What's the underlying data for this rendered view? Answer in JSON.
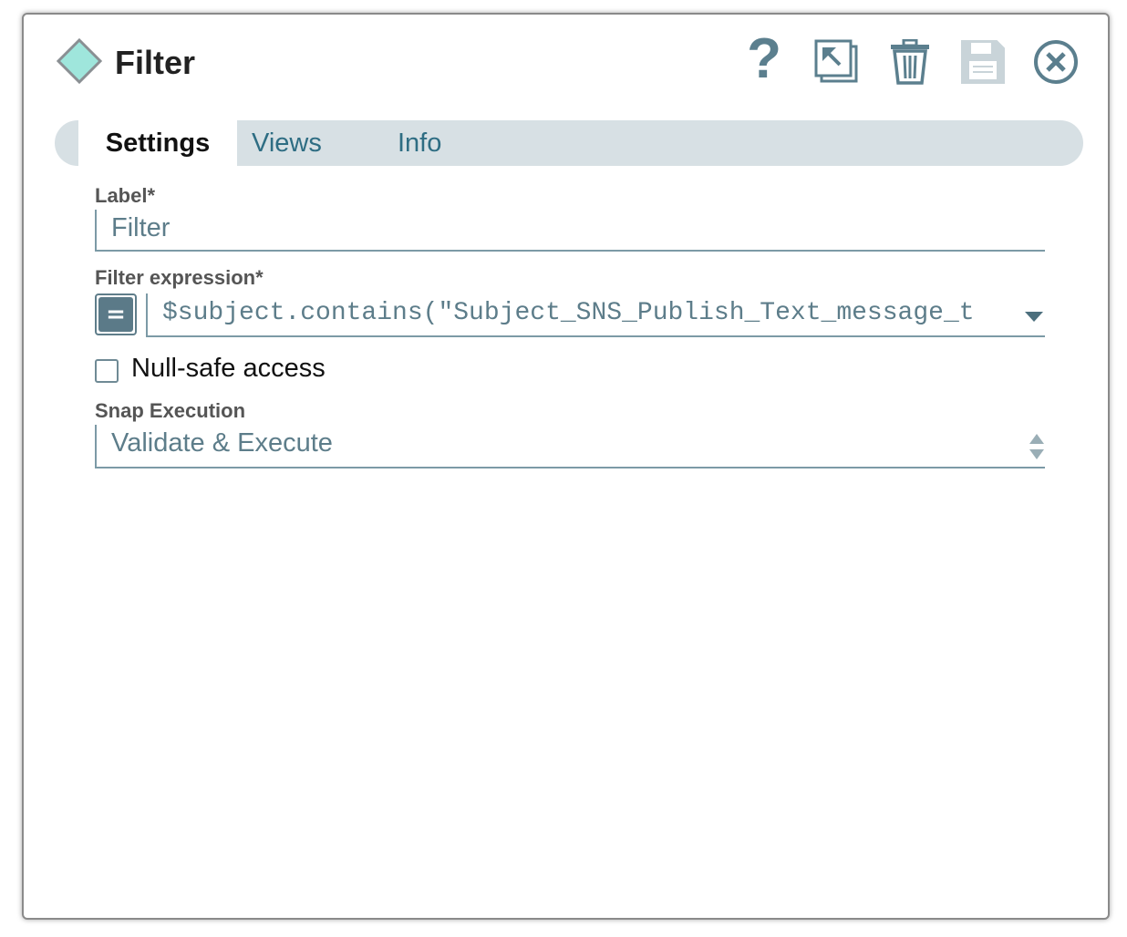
{
  "dialog": {
    "title": "Filter",
    "icon": "diamond-icon"
  },
  "toolbar": {
    "help_glyph": "?",
    "icons": [
      "help-icon",
      "export-icon",
      "trash-icon",
      "save-icon",
      "close-icon"
    ]
  },
  "tabs": [
    {
      "label": "Settings",
      "active": true
    },
    {
      "label": "Views",
      "active": false
    },
    {
      "label": "Info",
      "active": false
    }
  ],
  "settings": {
    "label_field": {
      "label": "Label*",
      "value": "Filter"
    },
    "filter_expression": {
      "label": "Filter expression*",
      "expression_toggle": "=",
      "value": "$subject.contains(\"Subject_SNS_Publish_Text_message_t"
    },
    "null_safe": {
      "label": "Null-safe access",
      "checked": false
    },
    "snap_execution": {
      "label": "Snap Execution",
      "value": "Validate & Execute"
    }
  },
  "colors": {
    "accent": "#5b7f8e",
    "tab_bar": "#d7e0e4",
    "diamond_fill": "#9fe6dc",
    "field_text": "#5d7d8a"
  }
}
